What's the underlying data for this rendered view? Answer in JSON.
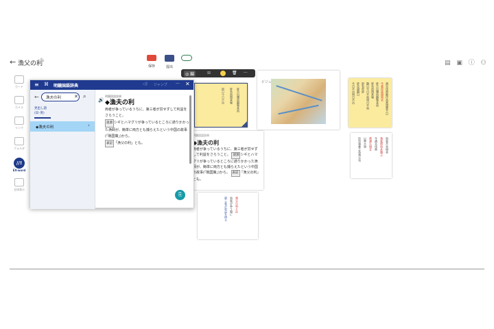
{
  "topbar": {
    "back": "←",
    "title": "漁父の利",
    "edit": "✎",
    "tools": [
      {
        "label": "保存"
      },
      {
        "label": "提出"
      },
      {
        "label": "グループ"
      }
    ],
    "right_icons": "▤ ▣ ⓘ ⚇"
  },
  "float_toolbar": {
    "mode": "◎ 編",
    "grid": "⊞",
    "color": "#f6d04a",
    "delete": "🗑",
    "more": "···"
  },
  "sidebar": {
    "items": [
      {
        "label": "カード",
        "icon": "card-icon"
      },
      {
        "label": "カメラ",
        "icon": "camera-icon"
      },
      {
        "label": "リンク",
        "icon": "link-icon"
      },
      {
        "label": "フォルダ",
        "icon": "folder-icon"
      },
      {
        "label": "EX-word",
        "badge": "//!",
        "icon": "exword-icon"
      },
      {
        "label": "全体表示",
        "icon": "overview-icon"
      }
    ]
  },
  "dictionary": {
    "menu": "≡",
    "logo": "⌘",
    "name": "明鏡国語辞典",
    "audio": "◁)",
    "jump": "ジャンプ",
    "more": "···",
    "close": "✕",
    "back": "←",
    "search_value": "漁夫の利",
    "clear": "✕",
    "search_icon": "⌕",
    "tab_label": "見出し語\n(日･英)",
    "result": "◆漁夫の利",
    "result_chevron": "›",
    "source": "明鏡国語辞典",
    "speaker": "🔊",
    "headword": "◆漁夫の利",
    "body": "両者が争っているうちに、第三者が労せずして利益をさらうこと。",
    "chip_origin": "語源",
    "origin_text": "シギとハマグリが争っているところに通りかかった漁師が、簡単に両方とも捕らえたという中国の故事(「戦国策」)から。",
    "chip_usage": "表記",
    "usage_text": "「漁父の利」とも。",
    "fab": "⎘"
  },
  "cards": {
    "card2": {
      "source": "明鏡国語辞典",
      "headword": "◆漁夫の利",
      "body": "両者が争っているうちに、第三者が労せずして利益をさらうこと。",
      "chip_origin": "語源",
      "origin_text": "シギとハマグリが争っているところに通りかかった漁師が、簡単に両方とも捕らえたという中国の故事(「戦国策」)から。",
      "chip_usage": "表記",
      "usage_text": "「漁父の利」とも。"
    },
    "card3": {
      "caption": "ビジュアルカラー国語便覧"
    }
  }
}
